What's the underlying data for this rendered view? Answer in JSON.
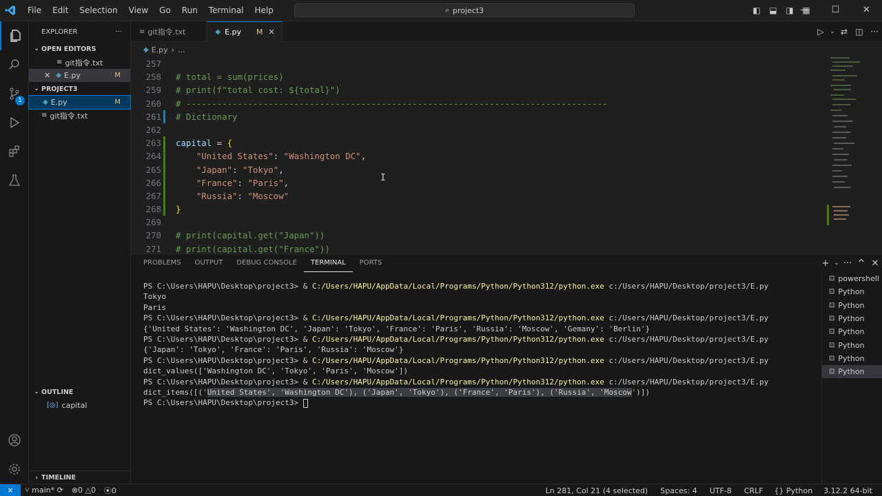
{
  "titlebar": {
    "menu": [
      "File",
      "Edit",
      "Selection",
      "View",
      "Go",
      "Run",
      "Terminal",
      "Help"
    ],
    "search": "project3"
  },
  "explorer": {
    "title": "EXPLORER",
    "open_editors": "OPEN EDITORS",
    "open_files": [
      {
        "name": "git指令.txt",
        "status": ""
      },
      {
        "name": "E.py",
        "status": "M"
      }
    ],
    "project": "PROJECT3",
    "files": [
      {
        "name": "E.py",
        "status": "M"
      },
      {
        "name": "git指令.txt",
        "status": ""
      }
    ],
    "outline": "OUTLINE",
    "outline_item": "capital",
    "timeline": "TIMELINE"
  },
  "tabs": [
    {
      "name": "git指令.txt",
      "status": ""
    },
    {
      "name": "E.py",
      "status": "M"
    }
  ],
  "breadcrumb": {
    "file": "E.py",
    "rest": "..."
  },
  "editor": {
    "lines": [
      {
        "n": "257",
        "code": ""
      },
      {
        "n": "258",
        "code": "# total = sum(prices)"
      },
      {
        "n": "259",
        "code": "# print(f\"total cost: ${total}\")"
      },
      {
        "n": "260",
        "code": "# ----------------------------------------------------------------------------------"
      },
      {
        "n": "261",
        "code": "# Dictionary"
      },
      {
        "n": "262",
        "code": ""
      },
      {
        "n": "263",
        "var": "capital",
        "op": " = ",
        "br": "{"
      },
      {
        "n": "264",
        "key": "\"United States\"",
        "val": "\"Washington DC\"",
        "end": ","
      },
      {
        "n": "265",
        "key": "\"Japan\"",
        "val": "\"Tokyo\"",
        "end": ","
      },
      {
        "n": "266",
        "key": "\"France\"",
        "val": "\"Paris\"",
        "end": ","
      },
      {
        "n": "267",
        "key": "\"Russia\"",
        "val": "\"Moscow\"",
        "end": ""
      },
      {
        "n": "268",
        "br_close": "}"
      },
      {
        "n": "269",
        "code": ""
      },
      {
        "n": "270",
        "code": "# print(capital.get(\"Japan\"))"
      },
      {
        "n": "271",
        "code": "# print(capital.get(\"France\"))"
      }
    ]
  },
  "panel": {
    "tabs": [
      "PROBLEMS",
      "OUTPUT",
      "DEBUG CONSOLE",
      "TERMINAL",
      "PORTS"
    ],
    "active_tab": "TERMINAL",
    "prompt": "PS C:\\Users\\HAPU\\Desktop\\project3> & ",
    "exe": "C:/Users/HAPU/AppData/Local/Programs/Python/Python312/python.exe",
    "script": " c:/Users/HAPU/Desktop/project3/E.py",
    "outputs": [
      [
        "Tokyo",
        "Paris"
      ],
      [
        "{'United States': 'Washington DC', 'Japan': 'Tokyo', 'France': 'Paris', 'Russia': 'Moscow', 'Gemany': 'Berlin'}"
      ],
      [
        "{'Japan': 'Tokyo', 'France': 'Paris', 'Russia': 'Moscow'}"
      ],
      [
        "dict_values(['Washington DC', 'Tokyo', 'Paris', 'Moscow'])"
      ]
    ],
    "last_output_pre": "dict_items([('",
    "last_output_sel": "United States', 'Washington DC'), ('Japan', 'Tokyo'), ('France', 'Paris'), ('Russia', 'Moscow",
    "last_output_post": "')])",
    "final_prompt": "PS C:\\Users\\HAPU\\Desktop\\project3> ",
    "terminals": [
      "powershell",
      "Python",
      "Python",
      "Python",
      "Python",
      "Python",
      "Python",
      "Python"
    ]
  },
  "statusbar": {
    "branch": "main*",
    "errors": "0",
    "warnings": "0",
    "ports": "0",
    "position": "Ln 281, Col 21 (4 selected)",
    "spaces": "Spaces: 4",
    "encoding": "UTF-8",
    "eol": "CRLF",
    "language": "Python",
    "interpreter": "3.12.2 64-bit"
  },
  "colors": {
    "accent": "#0078d4",
    "modified": "#e2c08d",
    "comment": "#6a9955",
    "string": "#ce9178"
  }
}
